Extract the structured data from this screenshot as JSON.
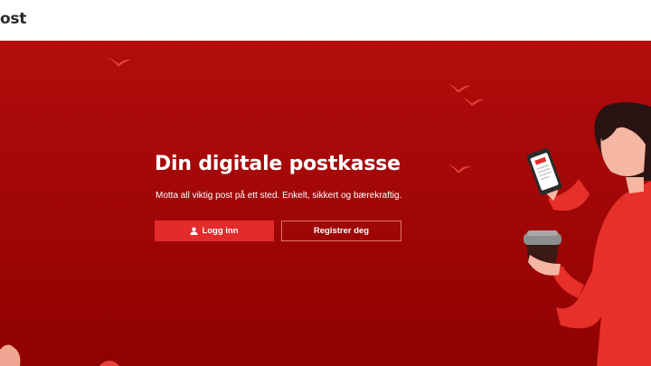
{
  "header": {
    "brand": "ost"
  },
  "hero": {
    "title": "Din digitale postkasse",
    "subtitle": "Motta all viktig post på ett sted. Enkelt, sikkert og bærekraftig.",
    "login_label": "Logg inn",
    "register_label": "Registrer deg"
  },
  "icons": {
    "login": "user-icon",
    "birds": "bird-icon",
    "illustration": "person-with-phone-and-coffee"
  },
  "colors": {
    "hero_background": "#a00606",
    "primary_button": "#e32b2b",
    "outline_button_border": "#e47373",
    "bird": "#e8403b",
    "text_light": "#ffffff"
  }
}
